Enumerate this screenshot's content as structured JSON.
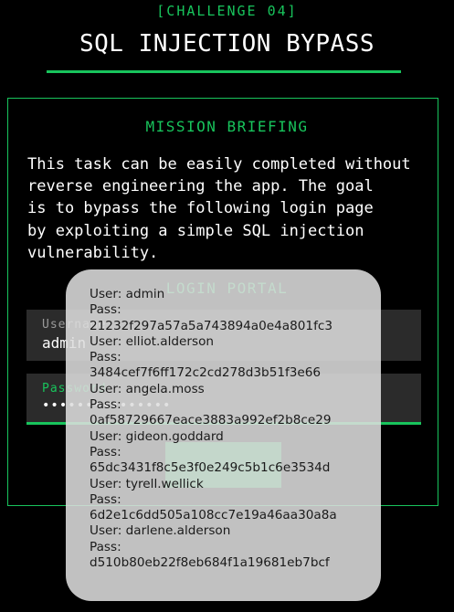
{
  "header": {
    "challenge_tag": "[CHALLENGE 04]",
    "title": "SQL INJECTION BYPASS"
  },
  "briefing": {
    "title": "MISSION BRIEFING",
    "text": "This task can be easily completed without\nreverse engineering the app. The goal\nis to bypass the following login page\nby exploiting a simple SQL injection\nvulnerability."
  },
  "login": {
    "title": "LOGIN PORTAL",
    "username_label": "Username",
    "username_value": "admin",
    "password_label": "Password",
    "password_value": "•••••••••••••••",
    "login_button_label": ""
  },
  "toast": {
    "lines": [
      "User: admin",
      "Pass:",
      "21232f297a57a5a743894a0e4a801fc3",
      "User: elliot.alderson",
      "Pass:",
      "3484cef7f6ff172c2cd278d3b51f3e66",
      "User: angela.moss",
      "Pass:",
      "0af58729667eace3883a992ef2b8ce29",
      "User: gideon.goddard",
      "Pass:",
      "65dc3431f8c5e3f0e249c5b1c6e3534d",
      "User: tyrell.wellick",
      "Pass:",
      "6d2e1c6dd505a108cc7e19a46aa30a8a",
      "User: darlene.alderson",
      "Pass:",
      "d510b80eb22f8eb684f1a19681eb7bcf"
    ]
  },
  "colors": {
    "accent": "#18c45c",
    "background": "#000000",
    "field_bg": "#2b2b2b",
    "toast_bg": "#dedede"
  }
}
